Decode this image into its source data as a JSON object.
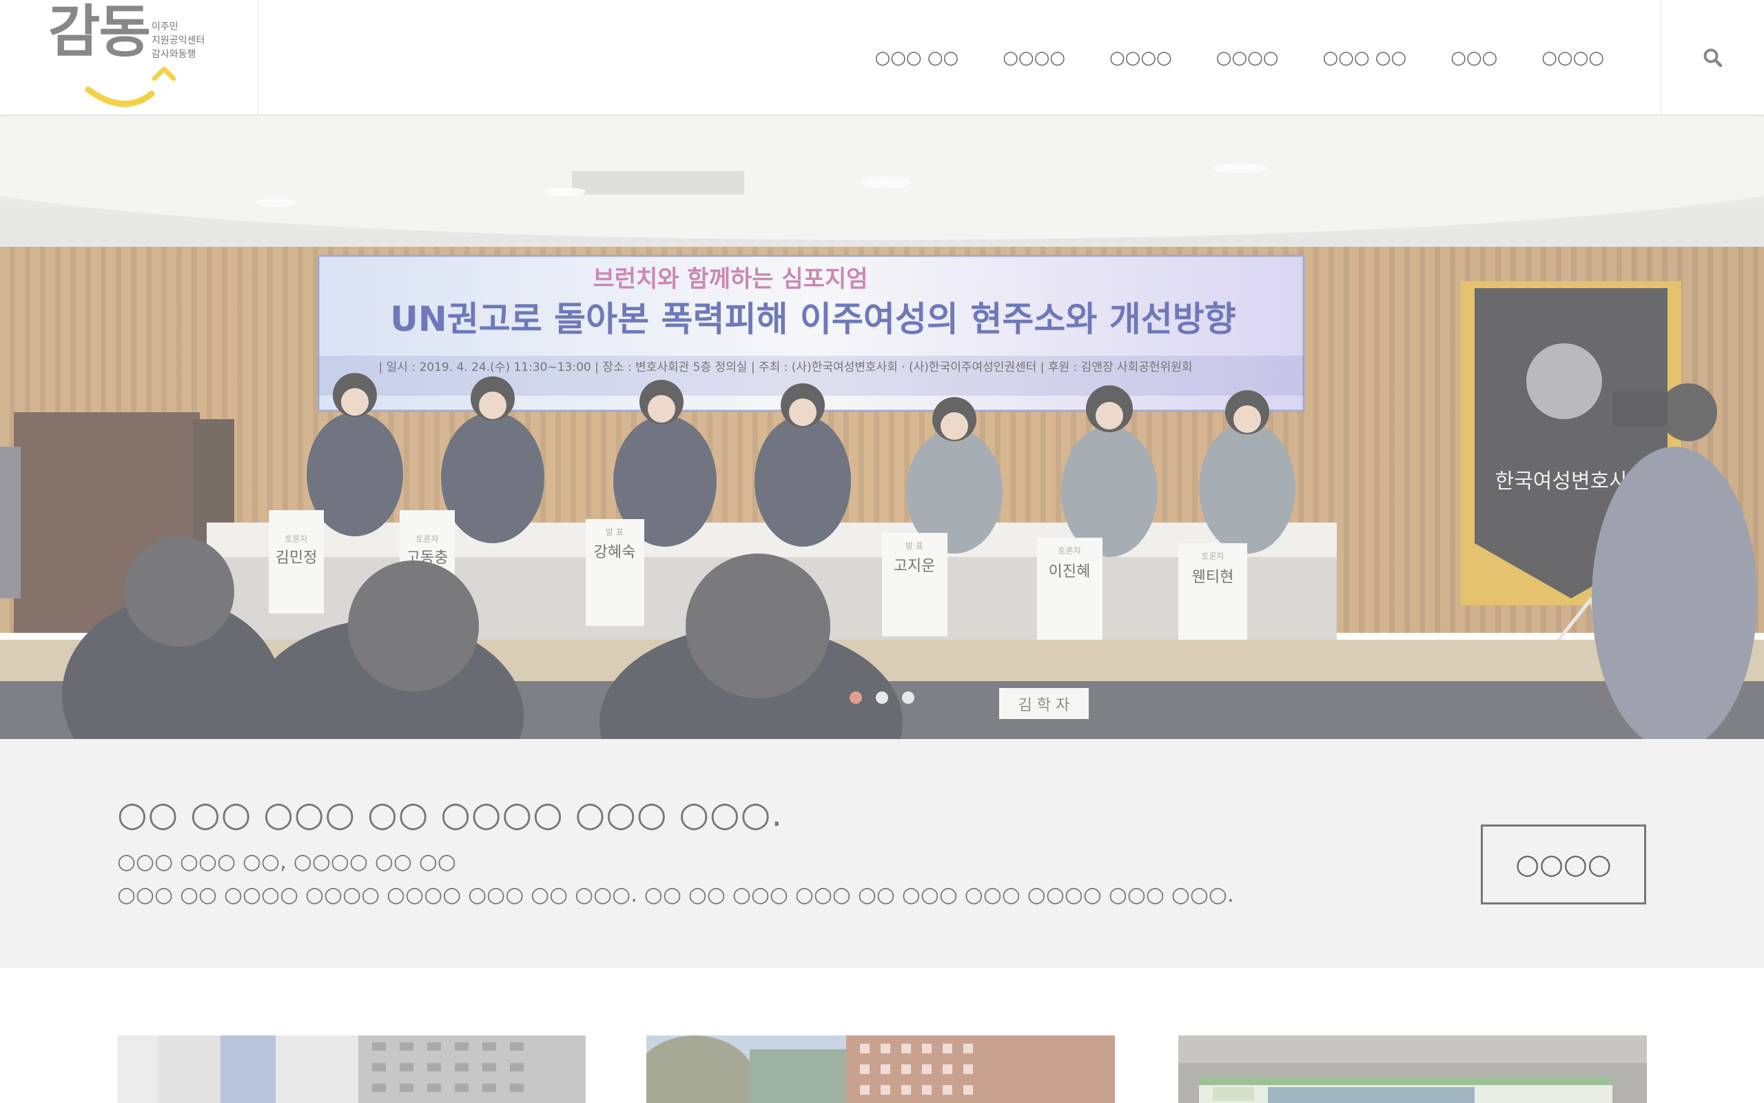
{
  "logo": {
    "mark": "감동",
    "subtitle_lines": [
      "이주민",
      "지원공익센터",
      "감사와동행"
    ],
    "accent_color": "#f3d24a"
  },
  "nav": {
    "items": [
      "○○○ ○○",
      "○○○○",
      "○○○○",
      "○○○○",
      "○○○ ○○",
      "○○○",
      "○○○○"
    ]
  },
  "search": {
    "icon": "search-icon"
  },
  "hero": {
    "slide_index": 0,
    "slide_count": 3,
    "banner": {
      "subtitle": "브런치와 함께하는 심포지엄",
      "title": "UN권고로 돌아본 폭력피해 이주여성의 현주소와 개선방향",
      "info": "| 일시 : 2019. 4. 24.(수) 11:30~13:00   | 장소 : 변호사회관 5층 정의실   | 주최 : (사)한국여성변호사회 · (사)한국이주여성인권센터   | 후원 : 김앤장 사회공헌위원회"
    },
    "flag_text": "한국여성변호사회",
    "nameplates": [
      {
        "role": "토론자",
        "name": "김민정"
      },
      {
        "role": "토론자",
        "name": "고동충"
      },
      {
        "role": "발 표",
        "name": "강혜숙"
      },
      {
        "role": "발 표",
        "name": "고지운"
      },
      {
        "role": "토론자",
        "name": "이진혜"
      },
      {
        "role": "토론자",
        "name": "웬티현"
      }
    ],
    "front_plate": "김 학 자"
  },
  "intro": {
    "title": "○○ ○○ ○○○ ○○ ○○○○ ○○○ ○○○.",
    "line1": "○○○ ○○○ ○○, ○○○○ ○○ ○○",
    "line2": "○○○ ○○ ○○○○ ○○○○ ○○○○ ○○○ ○○ ○○○. ○○ ○○ ○○○ ○○○ ○○ ○○○ ○○○ ○○○○ ○○○ ○○○.",
    "button_label": "○○○○"
  }
}
